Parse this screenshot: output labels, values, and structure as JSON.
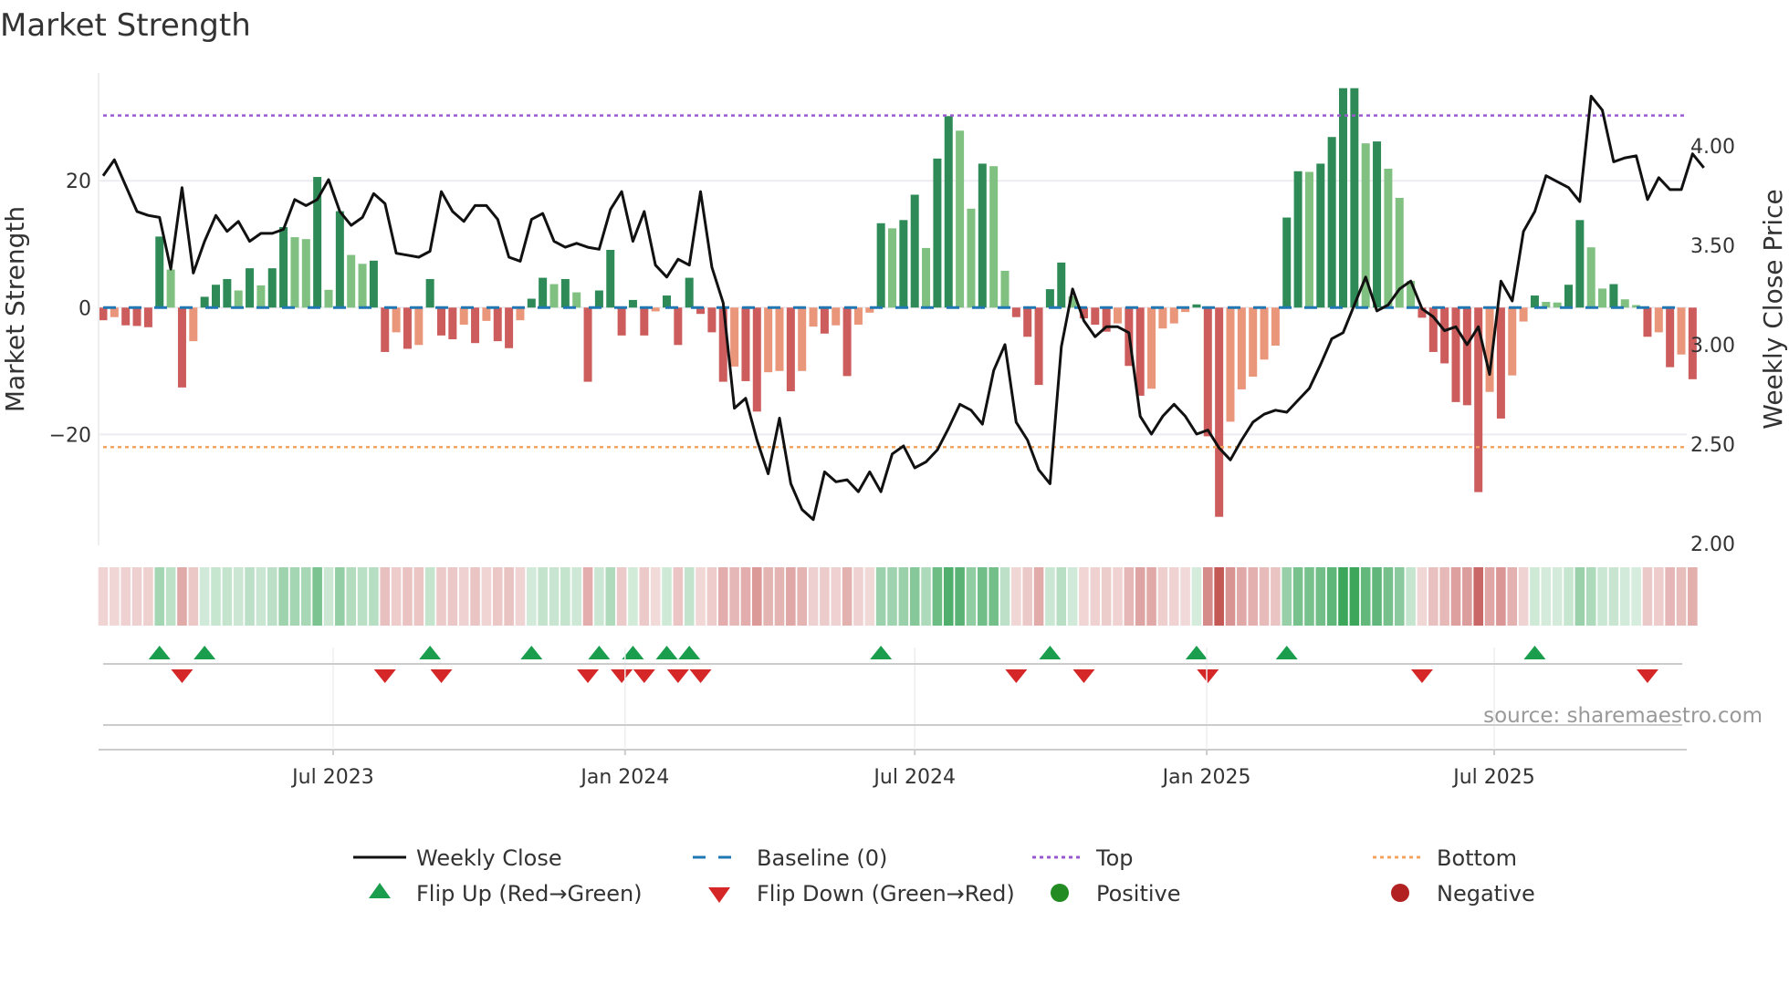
{
  "chart_data": {
    "type": "bar",
    "title": "Market Strength",
    "ylabel": "Market Strength",
    "y2label": "Weekly Close Price",
    "ylim": [
      -37.5,
      37.0
    ],
    "y2lim": [
      1.99,
      4.367
    ],
    "y_ticks": [
      {
        "label": "20",
        "value": 20
      },
      {
        "label": "0",
        "value": 0
      },
      {
        "label": "−20",
        "value": -20
      }
    ],
    "y2_ticks": [
      {
        "label": "4.00",
        "value": 4.0
      },
      {
        "label": "3.50",
        "value": 3.5
      },
      {
        "label": "3.00",
        "value": 3.0
      },
      {
        "label": "2.50",
        "value": 2.5
      },
      {
        "label": "2.00",
        "value": 2.0
      }
    ],
    "x_ticks": [
      {
        "label": "Jul 2023",
        "week": 20.4
      },
      {
        "label": "Jan 2024",
        "week": 46.3
      },
      {
        "label": "Jul 2024",
        "week": 72.0
      },
      {
        "label": "Jan 2025",
        "week": 97.9
      },
      {
        "label": "Jul 2025",
        "week": 123.4
      }
    ],
    "top_level": 30.3,
    "bottom_level": -22.0,
    "baseline": 0,
    "strength": [
      -2.0,
      -1.5,
      -2.8,
      -2.9,
      -3.1,
      11.2,
      6.0,
      -12.6,
      -5.3,
      1.7,
      3.6,
      4.5,
      2.7,
      6.2,
      3.5,
      6.2,
      12.7,
      11.1,
      10.8,
      20.6,
      2.8,
      15.2,
      8.3,
      6.9,
      7.4,
      -7.0,
      -3.9,
      -6.5,
      -5.9,
      4.5,
      -4.4,
      -5.0,
      -2.7,
      -5.6,
      -2.1,
      -5.3,
      -6.4,
      -2.0,
      1.4,
      4.7,
      3.7,
      4.5,
      2.4,
      -11.7,
      2.7,
      9.1,
      -4.4,
      1.2,
      -4.4,
      -0.6,
      1.9,
      -5.9,
      4.7,
      -1.0,
      -3.9,
      -11.7,
      -9.3,
      -11.6,
      -16.4,
      -10.2,
      -10.0,
      -13.2,
      -10.0,
      -3.0,
      -4.1,
      -2.8,
      -10.8,
      -2.7,
      -0.8,
      13.3,
      12.5,
      13.8,
      17.8,
      9.4,
      23.5,
      30.2,
      27.9,
      15.6,
      22.7,
      22.3,
      5.8,
      -1.5,
      -4.6,
      -12.2,
      2.9,
      7.1,
      1.8,
      -1.7,
      -2.7,
      -3.8,
      -2.5,
      -9.2,
      -13.9,
      -12.8,
      -3.3,
      -2.5,
      -0.7,
      0.5,
      -20.3,
      -33.0,
      -18.0,
      -12.9,
      -10.9,
      -8.2,
      -6.0,
      14.2,
      21.5,
      21.4,
      22.7,
      26.9,
      34.6,
      34.6,
      25.9,
      26.2,
      21.9,
      17.3,
      4.2,
      -1.6,
      -7.0,
      -8.8,
      -14.9,
      -15.4,
      -29.1,
      -13.3,
      -17.5,
      -10.7,
      -2.2,
      1.9,
      0.9,
      0.8,
      3.6,
      13.8,
      9.5,
      3.0,
      3.7,
      1.3,
      0.4,
      -4.6,
      -3.9,
      -9.4,
      -7.4,
      -11.3
    ],
    "weekly_close": [
      3.85,
      3.93,
      3.8,
      3.67,
      3.65,
      3.64,
      3.38,
      3.79,
      3.36,
      3.52,
      3.65,
      3.57,
      3.62,
      3.52,
      3.56,
      3.56,
      3.58,
      3.73,
      3.7,
      3.73,
      3.83,
      3.67,
      3.6,
      3.64,
      3.76,
      3.71,
      3.46,
      3.45,
      3.44,
      3.47,
      3.77,
      3.67,
      3.62,
      3.7,
      3.7,
      3.63,
      3.44,
      3.42,
      3.63,
      3.66,
      3.52,
      3.49,
      3.51,
      3.49,
      3.48,
      3.68,
      3.77,
      3.52,
      3.67,
      3.4,
      3.34,
      3.43,
      3.4,
      3.77,
      3.39,
      3.21,
      2.68,
      2.73,
      2.52,
      2.35,
      2.63,
      2.3,
      2.17,
      2.12,
      2.36,
      2.31,
      2.32,
      2.26,
      2.36,
      2.26,
      2.45,
      2.49,
      2.38,
      2.41,
      2.47,
      2.58,
      2.7,
      2.67,
      2.6,
      2.87,
      3.0,
      2.61,
      2.52,
      2.37,
      2.3,
      2.99,
      3.28,
      3.12,
      3.04,
      3.09,
      3.09,
      3.06,
      2.64,
      2.55,
      2.64,
      2.7,
      2.64,
      2.55,
      2.57,
      2.48,
      2.42,
      2.52,
      2.61,
      2.65,
      2.67,
      2.66,
      2.72,
      2.78,
      2.9,
      3.03,
      3.06,
      3.2,
      3.34,
      3.17,
      3.2,
      3.28,
      3.32,
      3.18,
      3.14,
      3.07,
      3.09,
      3.0,
      3.09,
      2.85,
      3.32,
      3.22,
      3.57,
      3.67,
      3.85,
      3.82,
      3.79,
      3.72,
      4.25,
      4.18,
      3.92,
      3.94,
      3.95,
      3.73,
      3.84,
      3.78,
      3.78,
      3.96,
      3.89
    ],
    "colors": {
      "strong_green": "#2e8b57",
      "weak_green": "#80c080",
      "strong_red": "#cd5c5c",
      "weak_red": "#e9967a",
      "close_line": "#111111",
      "baseline": "#1f77b4",
      "top": "#9b59d0",
      "bottom": "#f4a460",
      "flip_up": "#1a9e4e",
      "flip_down": "#d62728",
      "positive": "#228b22",
      "negative": "#b22222"
    },
    "legend": {
      "weekly_close": "Weekly Close",
      "baseline": "Baseline (0)",
      "top": "Top",
      "bottom": "Bottom",
      "flip_up": "Flip Up (Red→Green)",
      "flip_down": "Flip Down (Green→Red)",
      "positive": "Positive",
      "negative": "Negative"
    },
    "legend_placement": "bottom-center",
    "source": "source: sharemaestro.com"
  }
}
